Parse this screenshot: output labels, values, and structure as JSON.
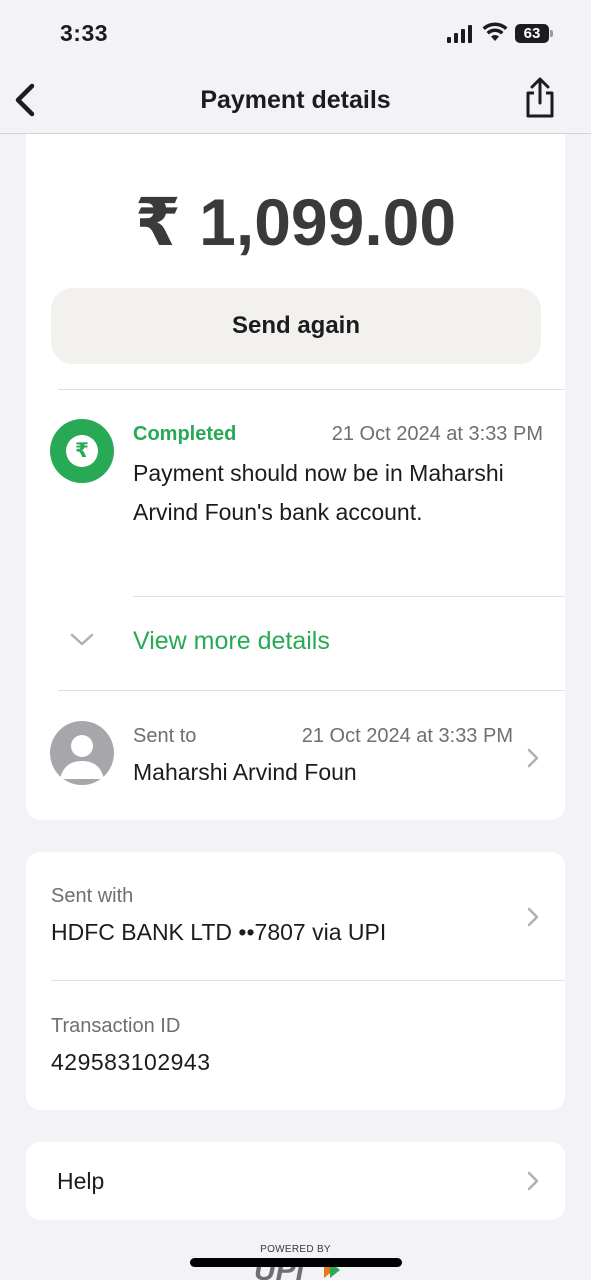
{
  "status_bar": {
    "time": "3:33",
    "battery": "63"
  },
  "nav": {
    "title": "Payment details"
  },
  "payment": {
    "amount": "₹ 1,099.00",
    "send_again_label": "Send again",
    "status_label": "Completed",
    "status_date": "21 Oct 2024 at 3:33 PM",
    "status_message": "Payment should now be in Maharshi Arvind Foun's bank account.",
    "rupee_symbol": "₹",
    "view_more_label": "View more details",
    "sent_to_label": "Sent to",
    "sent_to_date": "21 Oct 2024 at 3:33 PM",
    "sent_to_name": "Maharshi Arvind Foun"
  },
  "bank": {
    "sent_with_label": "Sent with",
    "sent_with_value": "HDFC BANK LTD ••7807 via UPI",
    "transaction_label": "Transaction ID",
    "transaction_id": "429583102943"
  },
  "help": {
    "label": "Help"
  },
  "footer": {
    "powered_by": "POWERED BY",
    "upi_text": "UPI"
  },
  "colors": {
    "accent_green": "#27a955",
    "background": "#f2f2f7",
    "card": "#ffffff"
  },
  "icons": [
    "back-chevron-icon",
    "share-icon",
    "rupee-icon",
    "chevron-down-icon",
    "person-icon",
    "chevron-right-icon",
    "signal-icon",
    "wifi-icon",
    "battery-icon"
  ]
}
